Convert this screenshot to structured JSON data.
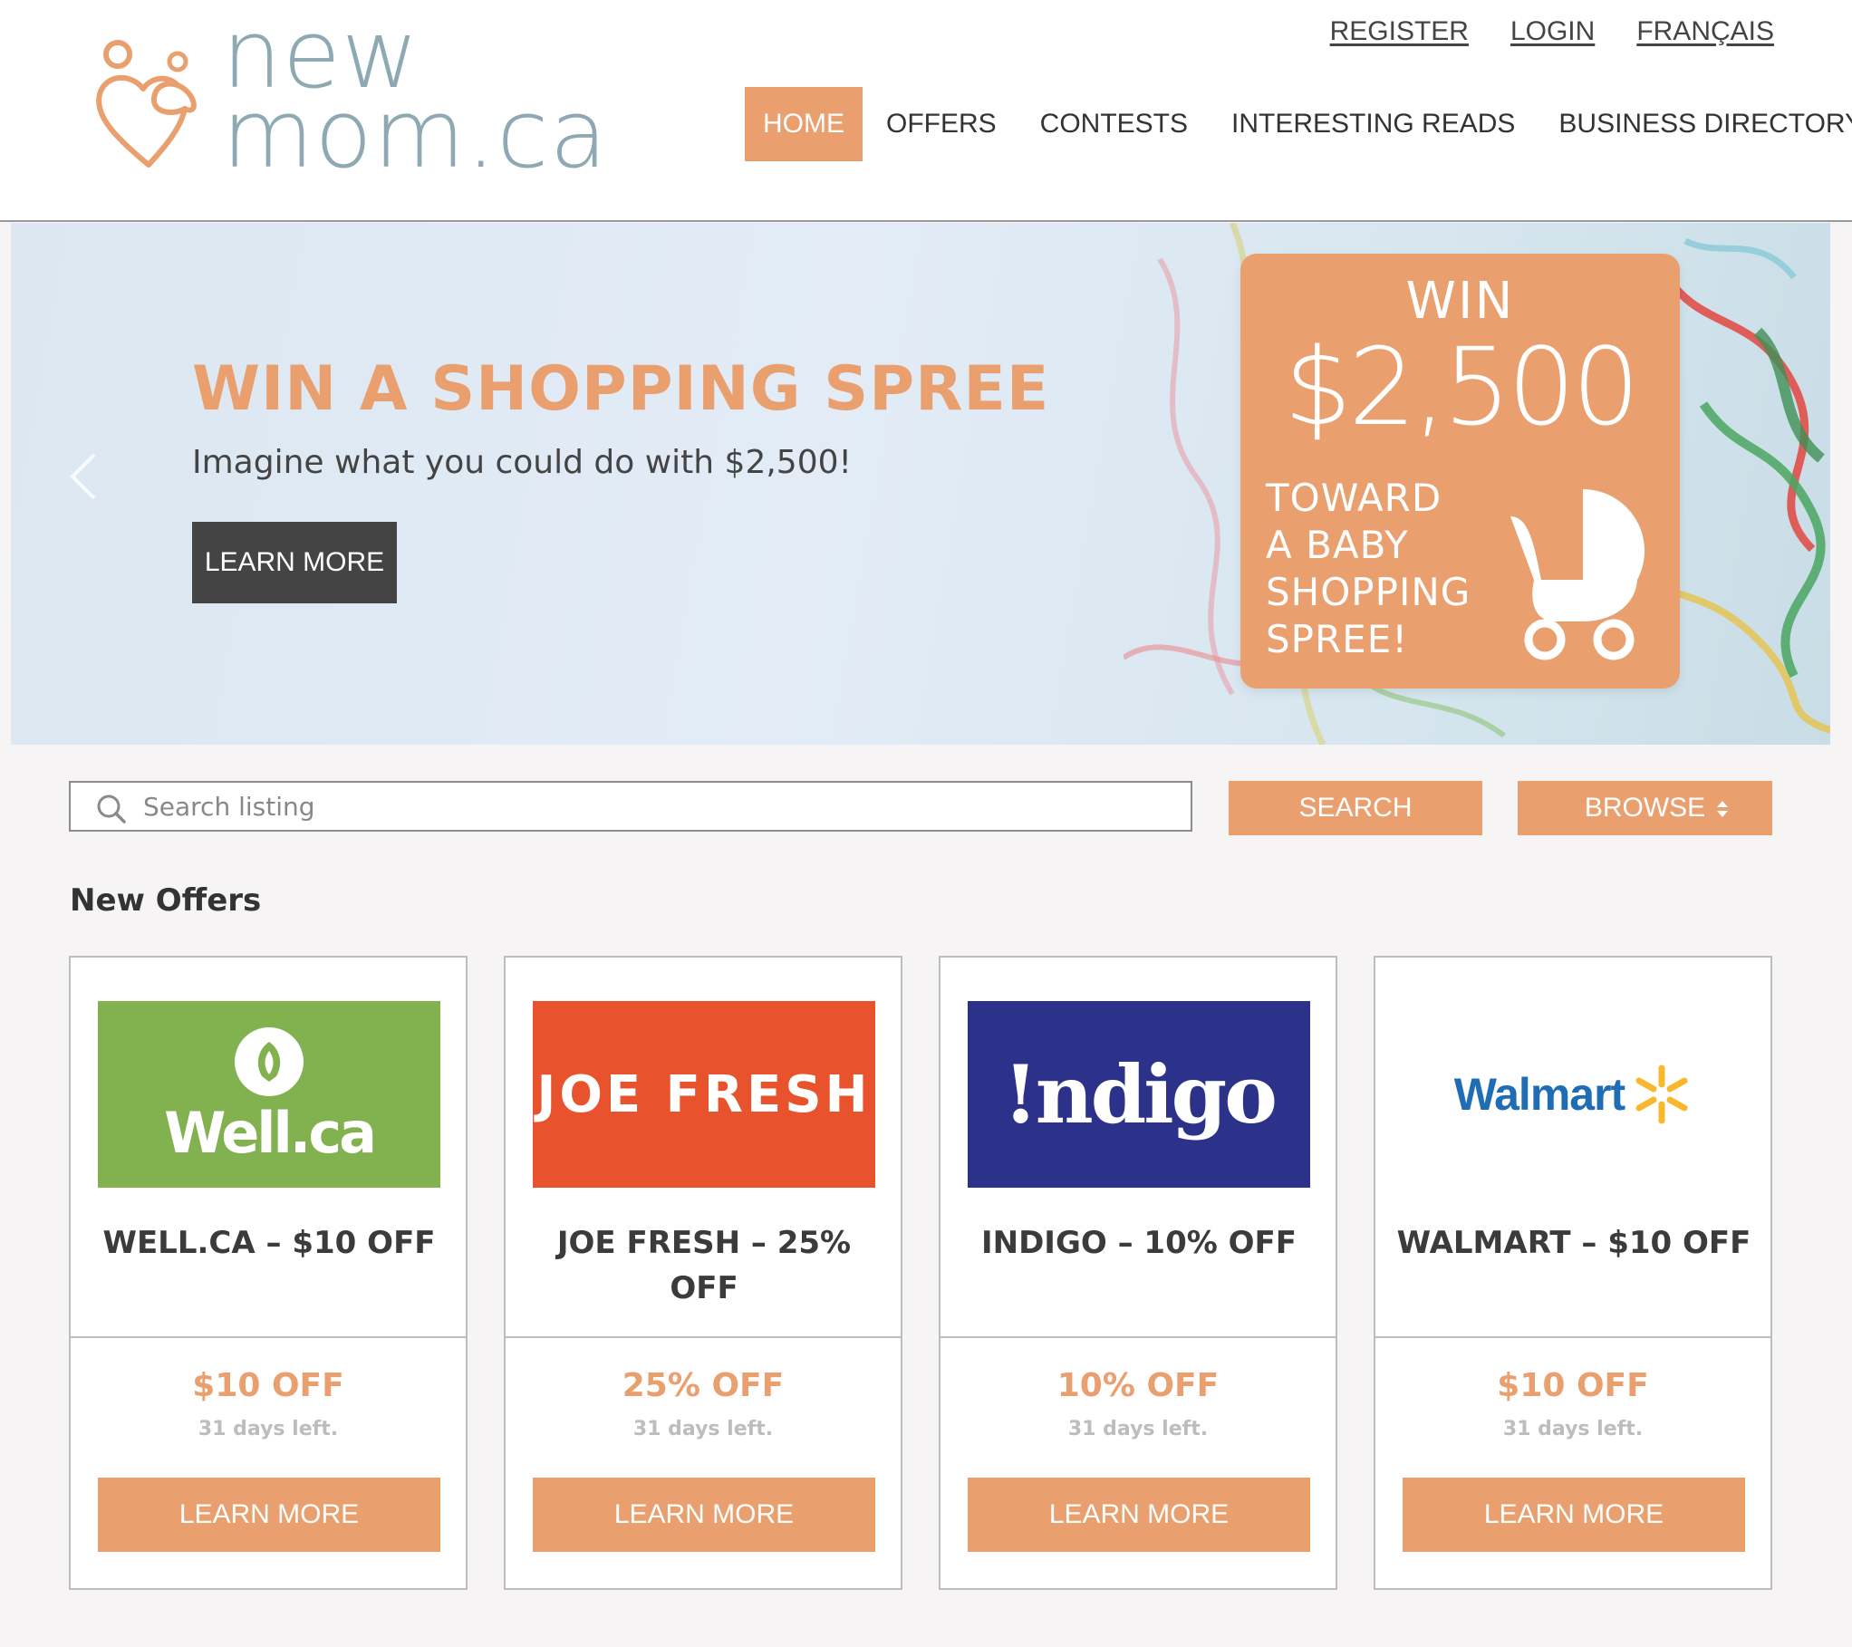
{
  "brand": {
    "logo_line1": "new",
    "logo_line2": "mom.ca",
    "accent_color": "#e9a06e",
    "logo_text_color": "#8fa9b3"
  },
  "top_links": {
    "register": "REGISTER",
    "login": "LOGIN",
    "language": "FRANÇAIS"
  },
  "nav": {
    "items": [
      {
        "label": "HOME",
        "active": true
      },
      {
        "label": "OFFERS",
        "active": false
      },
      {
        "label": "CONTESTS",
        "active": false
      },
      {
        "label": "INTERESTING READS",
        "active": false
      },
      {
        "label": "BUSINESS DIRECTORY",
        "active": false
      }
    ]
  },
  "hero": {
    "title": "WIN A SHOPPING SPREE",
    "subtitle": "Imagine what you could do with $2,500!",
    "button": "LEARN MORE",
    "promo": {
      "win": "WIN",
      "amount": "$2,500",
      "lines": [
        "TOWARD",
        "A BABY",
        "SHOPPING",
        "SPREE!"
      ]
    }
  },
  "search": {
    "placeholder": "Search listing",
    "search_button": "SEARCH",
    "browse_button": "BROWSE"
  },
  "offers": {
    "section_title": "New Offers",
    "cards": [
      {
        "logo_text": "Well.ca",
        "logo_bg": "#82b150",
        "title": "WELL.CA – $10 OFF",
        "discount": "$10 OFF",
        "days": "31 days left.",
        "button": "LEARN MORE"
      },
      {
        "logo_text": "JOE FRESH",
        "logo_bg": "#e8532e",
        "title": "JOE FRESH – 25% OFF",
        "discount": "25% OFF",
        "days": "31 days left.",
        "button": "LEARN MORE"
      },
      {
        "logo_text": "!ndigo",
        "logo_bg": "#2c318a",
        "title": "INDIGO – 10% OFF",
        "discount": "10% OFF",
        "days": "31 days left.",
        "button": "LEARN MORE"
      },
      {
        "logo_text": "Walmart",
        "logo_bg": "#ffffff",
        "title": "WALMART – $10 OFF",
        "discount": "$10 OFF",
        "days": "31 days left.",
        "button": "LEARN MORE"
      }
    ]
  }
}
